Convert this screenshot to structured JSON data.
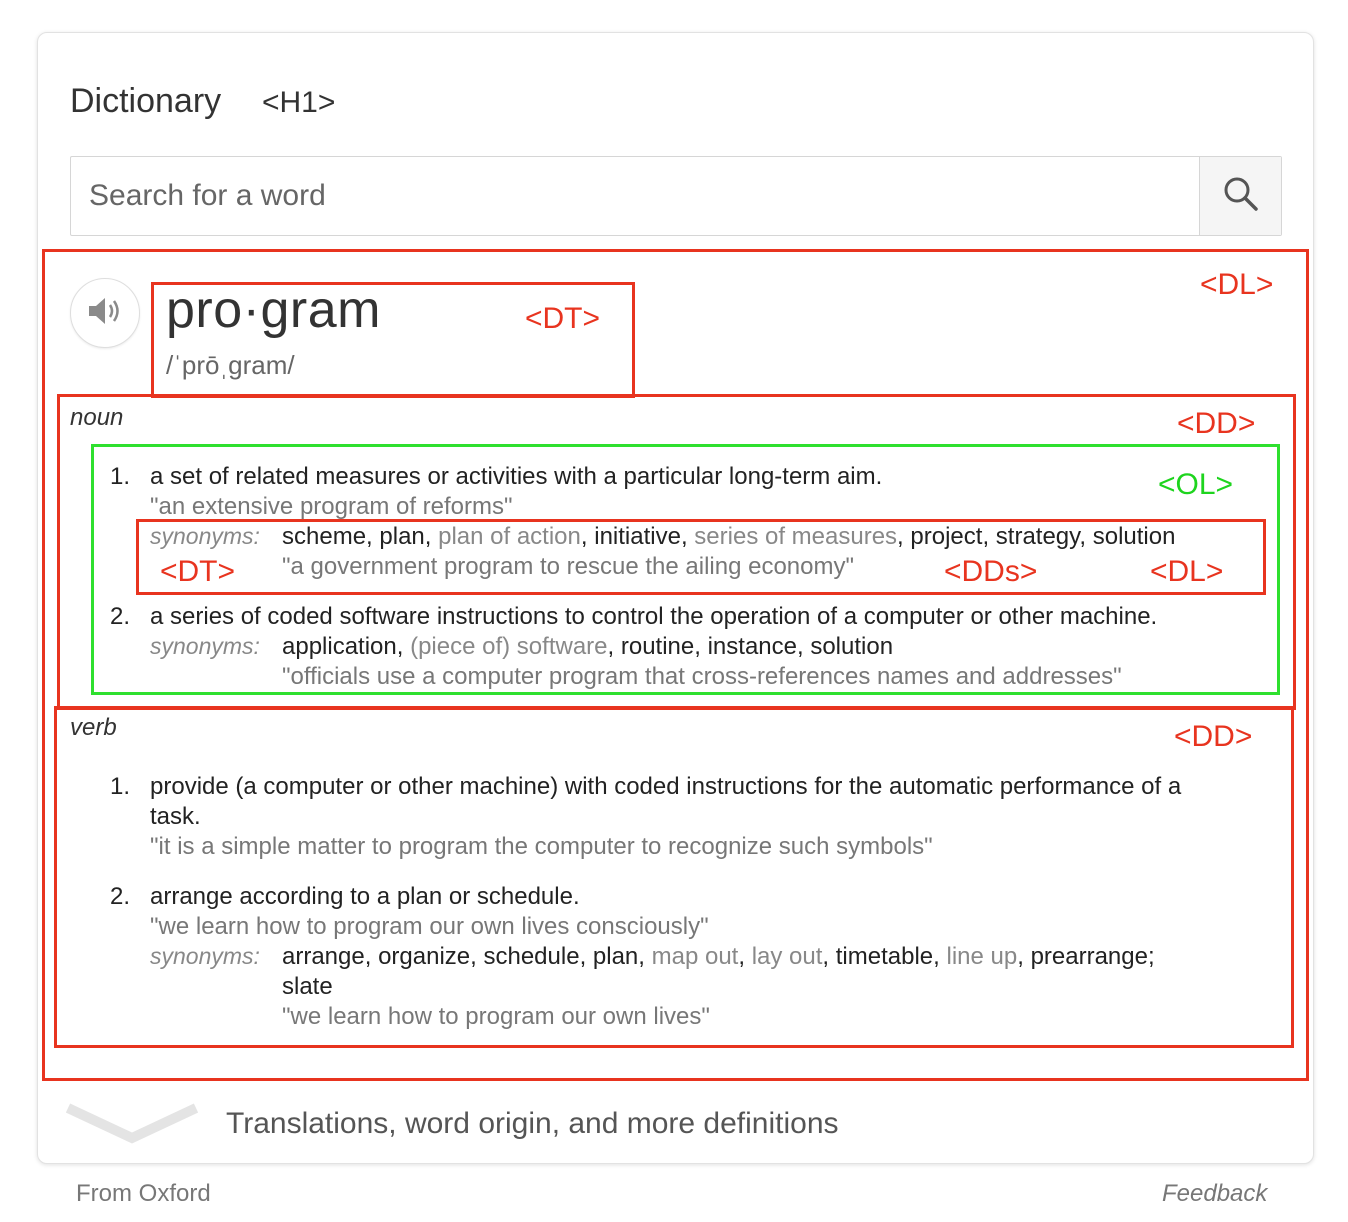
{
  "header": {
    "title": "Dictionary",
    "tag": "<H1>"
  },
  "search": {
    "placeholder": "Search for a word",
    "value": "",
    "icon": "search-icon"
  },
  "entry": {
    "headword": "pro·gram",
    "phonetic": "/ˈprōˌɡram/",
    "audio_icon": "speaker-icon"
  },
  "noun": {
    "label": "noun",
    "senses": [
      {
        "number": "1.",
        "definition": "a set of related measures or activities with a particular long-term aim.",
        "example": "\"an extensive program of reforms\"",
        "synonyms_label": "synonyms:",
        "synonyms": [
          {
            "text": "scheme",
            "strong": true
          },
          {
            "text": "plan",
            "strong": true
          },
          {
            "text": "plan of action",
            "strong": false
          },
          {
            "text": "initiative",
            "strong": true
          },
          {
            "text": "series of measures",
            "strong": false
          },
          {
            "text": "project",
            "strong": true
          },
          {
            "text": "strategy",
            "strong": true
          },
          {
            "text": "solution",
            "strong": true
          }
        ],
        "synonym_example": "\"a government program to rescue the ailing economy\""
      },
      {
        "number": "2.",
        "definition": "a series of coded software instructions to control the operation of a computer or other machine.",
        "synonyms_label": "synonyms:",
        "synonyms": [
          {
            "text": "application",
            "strong": true
          },
          {
            "text": "(piece of) software",
            "strong": false
          },
          {
            "text": "routine",
            "strong": true
          },
          {
            "text": "instance",
            "strong": true
          },
          {
            "text": "solution",
            "strong": true
          }
        ],
        "synonym_example": "\"officials use a computer program that cross-references names and addresses\""
      }
    ]
  },
  "verb": {
    "label": "verb",
    "senses": [
      {
        "number": "1.",
        "definition_line1": "provide (a computer or other machine) with coded instructions for the automatic performance of a",
        "definition_line2": "task.",
        "example": "\"it is a simple matter to program the computer to recognize such symbols\""
      },
      {
        "number": "2.",
        "definition": "arrange according to a plan or schedule.",
        "example": "\"we learn how to program our own lives consciously\"",
        "synonyms_label": "synonyms:",
        "synonyms": [
          {
            "text": "arrange",
            "strong": true
          },
          {
            "text": "organize",
            "strong": true
          },
          {
            "text": "schedule",
            "strong": true
          },
          {
            "text": "plan",
            "strong": true
          },
          {
            "text": "map out",
            "strong": false
          },
          {
            "text": "lay out",
            "strong": false
          },
          {
            "text": "timetable",
            "strong": true
          },
          {
            "text": "line up",
            "strong": false
          },
          {
            "text": "prearrange",
            "strong": true
          }
        ],
        "synonyms_end": ";",
        "synonyms_line2": "slate",
        "synonym_example": "\"we learn how to program our own lives\""
      }
    ]
  },
  "annotations": {
    "dl_outer": "<DL>",
    "dt_headword": "<DT>",
    "dd_noun": "<DD>",
    "ol": "<OL>",
    "dt_syn": "<DT>",
    "dds_syn": "<DDs>",
    "dl_syn": "<DL>",
    "dd_verb": "<DD>",
    "colors": {
      "red": "#e8341f",
      "green": "#2fe02f"
    }
  },
  "footer": {
    "more": "Translations, word origin, and more definitions",
    "expand_icon": "chevron-down-icon",
    "source": "From Oxford",
    "feedback": "Feedback"
  }
}
